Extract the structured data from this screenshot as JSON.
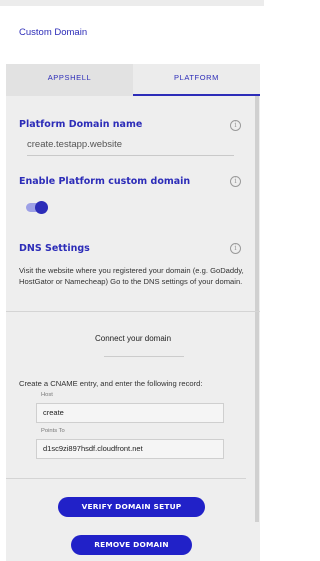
{
  "header": {
    "title": "Custom Domain"
  },
  "tabs": [
    {
      "label": "APPSHELL",
      "active": false
    },
    {
      "label": "PLATFORM",
      "active": true
    }
  ],
  "platform_domain": {
    "label": "Platform Domain name",
    "value": "create.testapp.website"
  },
  "custom_domain_toggle": {
    "label": "Enable Platform custom domain",
    "enabled": true
  },
  "dns_settings": {
    "label": "DNS Settings",
    "description": "Visit the website where you registered your domain (e.g. GoDaddy, HostGator or Namecheap) Go to the DNS settings of your domain."
  },
  "connect": {
    "title": "Connect your domain",
    "instruction": "Create a CNAME entry, and enter the following record:",
    "host_label": "Host",
    "host_value": "create",
    "points_to_label": "Points To",
    "points_to_value": "d1sc9zi897hsdf.cloudfront.net"
  },
  "buttons": {
    "verify": "VERIFY DOMAIN SETUP",
    "remove": "REMOVE DOMAIN"
  },
  "icons": {
    "info": "info-icon",
    "toggle": "toggle-switch"
  },
  "colors": {
    "accent": "#2c2cb8",
    "button": "#2121c8",
    "toggle_track": "#9da0e6",
    "panel_bg": "#eeeeee"
  }
}
